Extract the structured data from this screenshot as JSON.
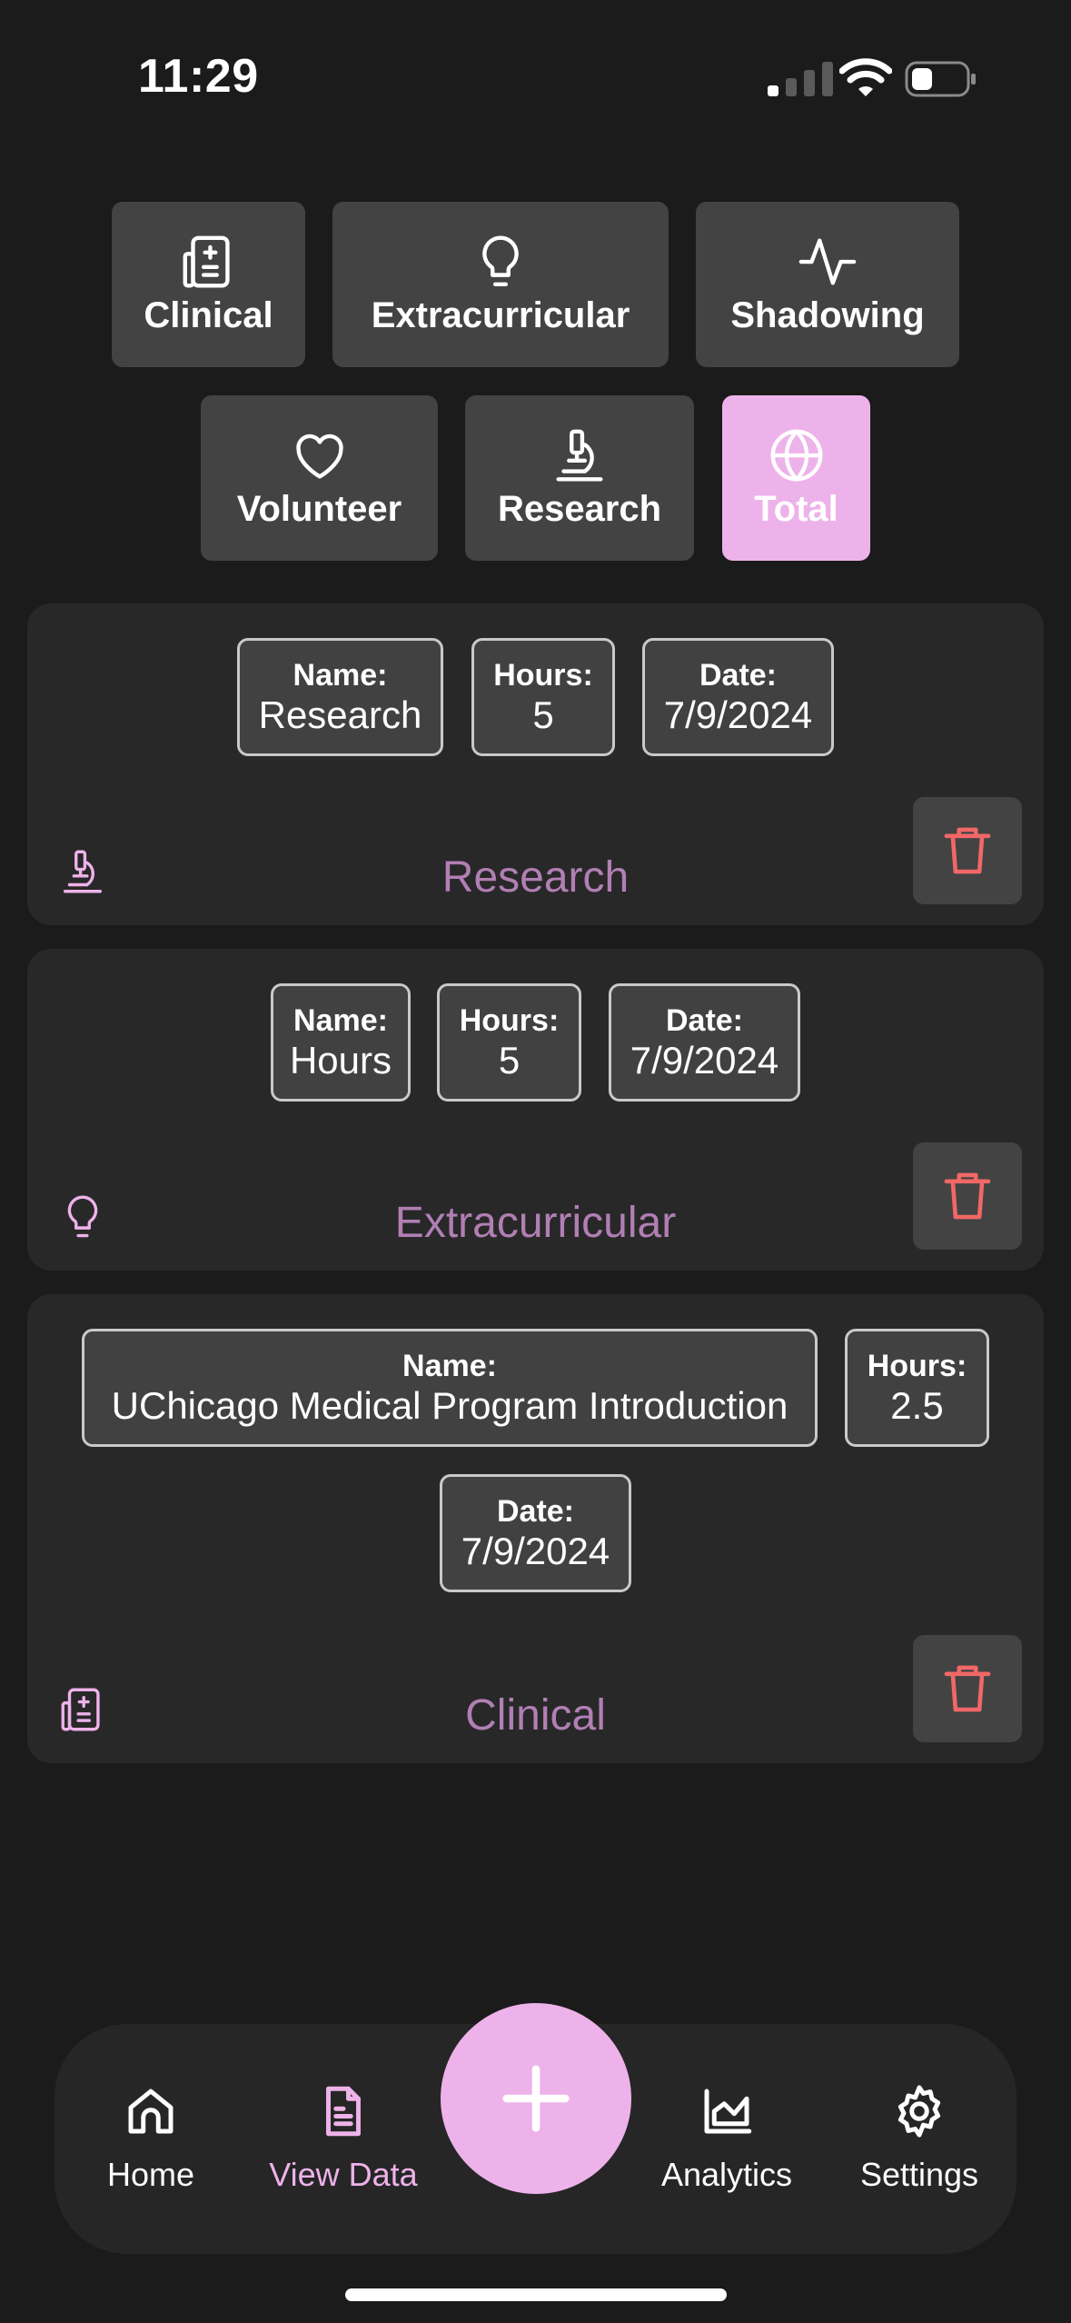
{
  "status_bar": {
    "time": "11:29"
  },
  "categories": {
    "clinical": "Clinical",
    "extracurricular": "Extracurricular",
    "shadowing": "Shadowing",
    "volunteer": "Volunteer",
    "research": "Research",
    "total": "Total",
    "active": "Total"
  },
  "field_labels": {
    "name": "Name:",
    "hours": "Hours:",
    "date": "Date:"
  },
  "entries": [
    {
      "name": "Research",
      "hours": "5",
      "date": "7/9/2024",
      "type": "Research",
      "icon": "microscope-icon"
    },
    {
      "name": "Hours",
      "hours": "5",
      "date": "7/9/2024",
      "type": "Extracurricular",
      "icon": "lightbulb-icon"
    },
    {
      "name": "UChicago Medical Program Introduction",
      "hours": "2.5",
      "date": "7/9/2024",
      "type": "Clinical",
      "icon": "clinical-icon"
    }
  ],
  "nav": {
    "home": "Home",
    "view_data": "View Data",
    "analytics": "Analytics",
    "settings": "Settings",
    "active": "View Data"
  },
  "colors": {
    "accent": "#eeb2ea",
    "background": "#1b1b1b",
    "card": "#282828",
    "chip": "#434343",
    "delete": "#f26767",
    "type_text": "#b17fb4"
  }
}
